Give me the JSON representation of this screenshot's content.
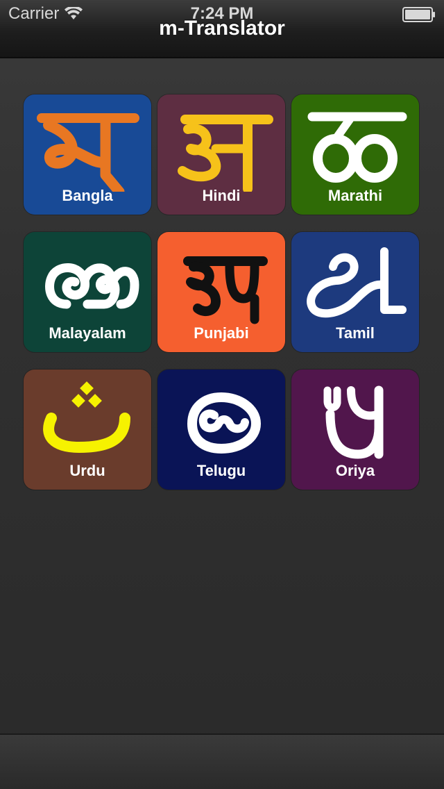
{
  "status_bar": {
    "carrier": "Carrier",
    "time": "7:24 PM"
  },
  "nav": {
    "title": "m-Translator"
  },
  "tiles": [
    {
      "label": "Bangla",
      "bg": "#184a96",
      "glyph_color": "#e87722"
    },
    {
      "label": "Hindi",
      "bg": "#5e2e42",
      "glyph_color": "#f6c21a"
    },
    {
      "label": "Marathi",
      "bg": "#2f6b06",
      "glyph_color": "#ffffff"
    },
    {
      "label": "Malayalam",
      "bg": "#0d4438",
      "glyph_color": "#ffffff"
    },
    {
      "label": "Punjabi",
      "bg": "#f55f2f",
      "glyph_color": "#111111"
    },
    {
      "label": "Tamil",
      "bg": "#1d3a7e",
      "glyph_color": "#ffffff"
    },
    {
      "label": "Urdu",
      "bg": "#6a3c2c",
      "glyph_color": "#f6f200"
    },
    {
      "label": "Telugu",
      "bg": "#0a1456",
      "glyph_color": "#ffffff"
    },
    {
      "label": "Oriya",
      "bg": "#51164c",
      "glyph_color": "#ffffff"
    }
  ]
}
